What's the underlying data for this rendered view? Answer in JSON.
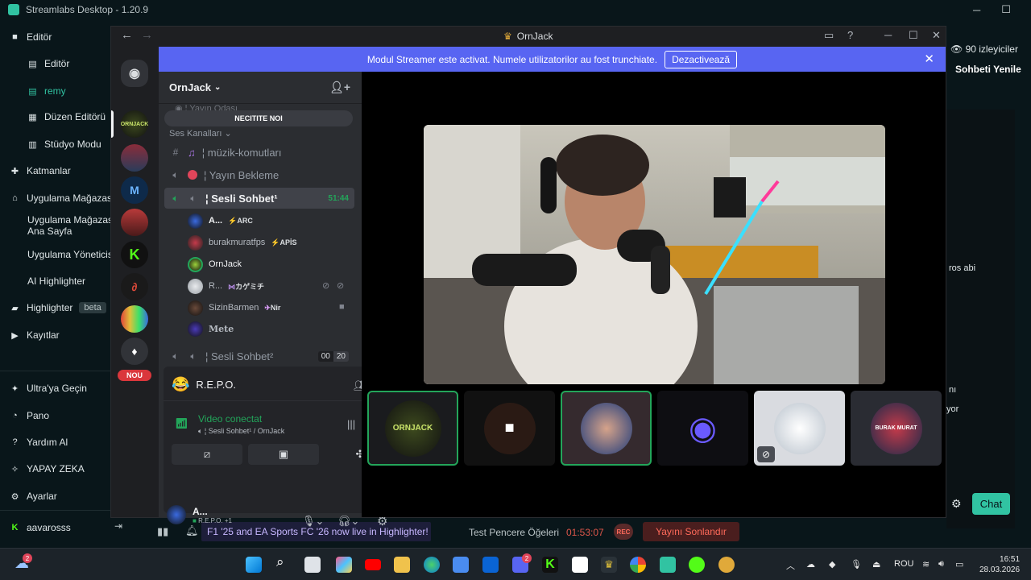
{
  "app": {
    "title": "Streamlabs Desktop - 1.20.9"
  },
  "sidebar": {
    "items": [
      {
        "label": "Editör",
        "icon": "editor-icon"
      },
      {
        "label": "Editör",
        "icon": "editor-icon"
      },
      {
        "label": "remy",
        "icon": "editor-icon"
      },
      {
        "label": "Düzen Editörü",
        "icon": "layout-icon"
      },
      {
        "label": "Stüdyo Modu",
        "icon": "studio-icon"
      },
      {
        "label": "Katmanlar",
        "icon": "puzzle-icon"
      },
      {
        "label": "Uygulama Mağazası",
        "icon": "store-icon"
      },
      {
        "label": "Uygulama Mağazası Ana Sayfa",
        "icon": ""
      },
      {
        "label": "Uygulama Yöneticisi",
        "icon": ""
      },
      {
        "label": "AI Highlighter",
        "icon": ""
      },
      {
        "label": "Highlighter",
        "icon": "highlighter-icon",
        "badge": "beta"
      },
      {
        "label": "Kayıtlar",
        "icon": "play-icon"
      },
      {
        "label": "Ultra'ya Geçin",
        "icon": "ultra-icon"
      },
      {
        "label": "Pano",
        "icon": "dashboard-icon"
      },
      {
        "label": "Yardım Al",
        "icon": "help-icon"
      },
      {
        "label": "YAPAY ZEKA",
        "icon": "sparkle-icon"
      },
      {
        "label": "Ayarlar",
        "icon": "gear-icon"
      },
      {
        "label": "aavarosss",
        "icon": "kick-icon"
      }
    ]
  },
  "right_panel": {
    "viewers": "90 izleyiciler",
    "chat_title": "Sohbeti Yenile",
    "frag1": "ros abi",
    "frag2": "nı",
    "frag3": "yor",
    "chat_button": "Chat"
  },
  "bottom_bar": {
    "promo": "F1 '25 and EA Sports FC '26 now live in Highlighter!",
    "test_label": "Test Pencere Öğeleri",
    "timer": "01:53:07",
    "rec": "REC",
    "end_stream": "Yayını Sonlandır"
  },
  "discord": {
    "title": "OrnJack",
    "banner_text": "Modul Streamer este activat. Numele utilizatorilor au fost trunchiate.",
    "banner_button": "Dezactivează",
    "server_name": "OrnJack",
    "new_messages": "NECITITE NOI",
    "category": "Ses Kanalları",
    "partial_channel": "Yayın Odası",
    "nou_badge": "NOU",
    "channels": [
      {
        "name": "müzik-komutları",
        "type": "text"
      },
      {
        "name": "Yayın Bekleme",
        "type": "voice"
      },
      {
        "name": "Sesli Sohbet¹",
        "type": "voice",
        "time": "51:44"
      },
      {
        "name": "Sesli Sohbet²",
        "type": "voice",
        "count_a": "00",
        "count_b": "20"
      }
    ],
    "voice_users": [
      {
        "name": "A...",
        "tag": "ARC"
      },
      {
        "name": "burakmuratfps",
        "tag": "APİS"
      },
      {
        "name": "OrnJack",
        "tag": ""
      },
      {
        "name": "R...",
        "tag": "カゲミチ"
      },
      {
        "name": "SizinBarmen",
        "tag": "Nir"
      },
      {
        "name": "Mete",
        "tag": ""
      }
    ],
    "activity": "R.E.P.O.",
    "voice_status": "Video conectat",
    "voice_channel": "Sesli Sohbet¹ / OrnJack",
    "me_name": "A...",
    "me_activity": "R.E.P.O. +1",
    "tiles": [
      {
        "label": "ORNJACK"
      },
      {
        "label": ""
      },
      {
        "label": ""
      },
      {
        "label": ""
      },
      {
        "label": ""
      },
      {
        "label": "BURAK MURAT"
      }
    ]
  },
  "taskbar": {
    "lang": "ROU",
    "time": "16:51",
    "date": "28.03.2026",
    "weather_badge": "2",
    "discord_badge": "2"
  },
  "colors": {
    "accent": "#31c3a2",
    "discord_blurple": "#5865f2",
    "speaking_green": "#23a55a"
  }
}
